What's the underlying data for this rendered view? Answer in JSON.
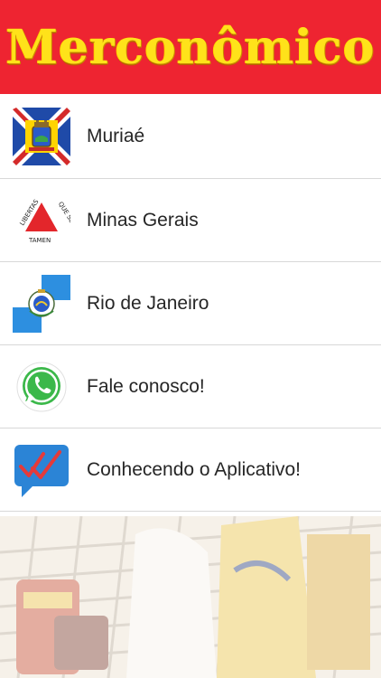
{
  "header": {
    "app_title": "Merconômico",
    "brand_bg_color": "#ee2431",
    "brand_text_color": "#ffe21a"
  },
  "menu": {
    "items": [
      {
        "label": "Muriaé",
        "icon": "muriae-flag-icon"
      },
      {
        "label": "Minas Gerais",
        "icon": "minas-gerais-flag-icon"
      },
      {
        "label": "Rio de Janeiro",
        "icon": "rio-de-janeiro-flag-icon"
      },
      {
        "label": "Fale conosco!",
        "icon": "whatsapp-icon"
      },
      {
        "label": "Conhecendo o Aplicativo!",
        "icon": "chat-checkmark-icon"
      }
    ]
  },
  "flags": {
    "minas_gerais": {
      "motto_left": "LIBERTAS",
      "motto_right": "QUE SERA",
      "motto_bottom": "TAMEN"
    }
  },
  "background": {
    "image": "shopping-cart-photo"
  }
}
